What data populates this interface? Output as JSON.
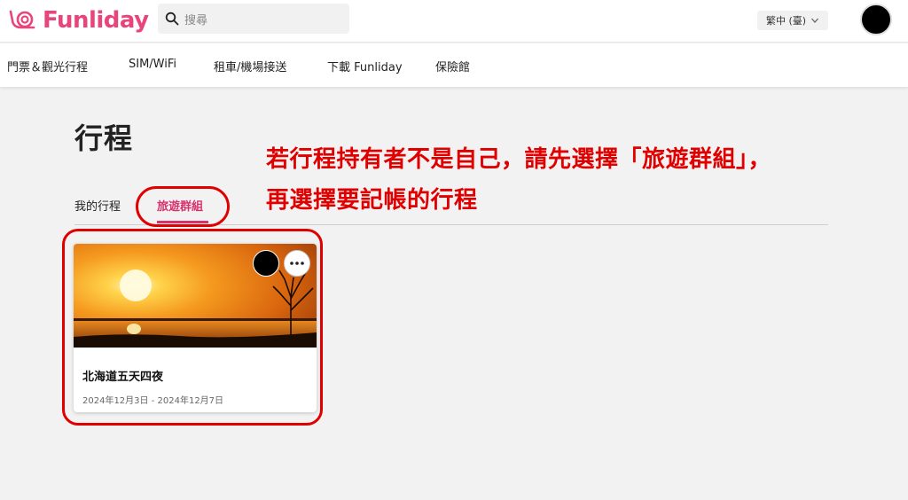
{
  "header": {
    "logo_text": "Funliday",
    "search": {
      "placeholder": "搜尋"
    },
    "language": "繁中 (臺)"
  },
  "nav": {
    "items": [
      {
        "label": "門票＆觀光行程"
      },
      {
        "label": "SIM/WiFi"
      },
      {
        "label": "租車/機場接送"
      },
      {
        "label": "下載 Funliday"
      },
      {
        "label": "保險館"
      }
    ]
  },
  "page": {
    "title": "行程",
    "tabs": [
      {
        "label": "我的行程",
        "active": false
      },
      {
        "label": "旅遊群組",
        "active": true
      }
    ]
  },
  "annotation": {
    "line1": "若行程持有者不是自己，請先選擇「旅遊群組」，",
    "line2": "再選擇要記帳的行程",
    "color": "#e00000"
  },
  "trip_card": {
    "title": "北海道五天四夜",
    "dates": "2024年12月3日 - 2024年12月7日"
  },
  "colors": {
    "brand": "#e8457d",
    "active_tab": "#d6336c"
  }
}
